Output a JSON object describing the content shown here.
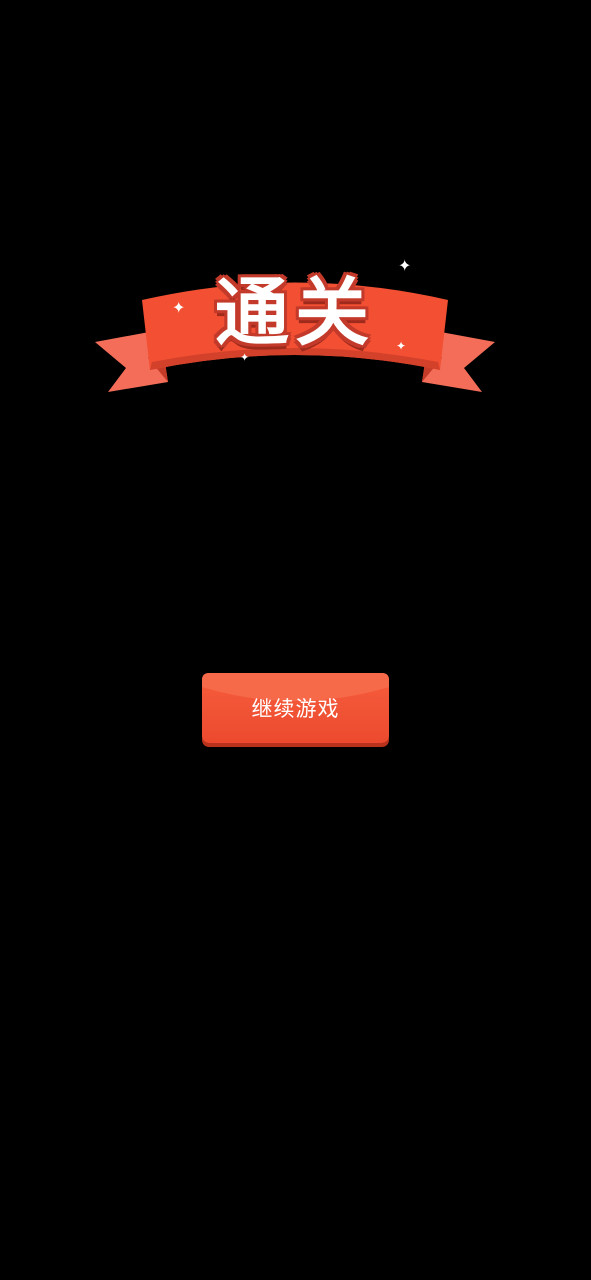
{
  "banner": {
    "title": "通关",
    "sparkle_icon": "sparkle-icon",
    "ribbon_color": "#f24f33",
    "ribbon_dark_color": "#c53b27",
    "ribbon_tail_color": "#f36d59"
  },
  "continue_button": {
    "label": "继续游戏",
    "color": "#f0502f"
  }
}
